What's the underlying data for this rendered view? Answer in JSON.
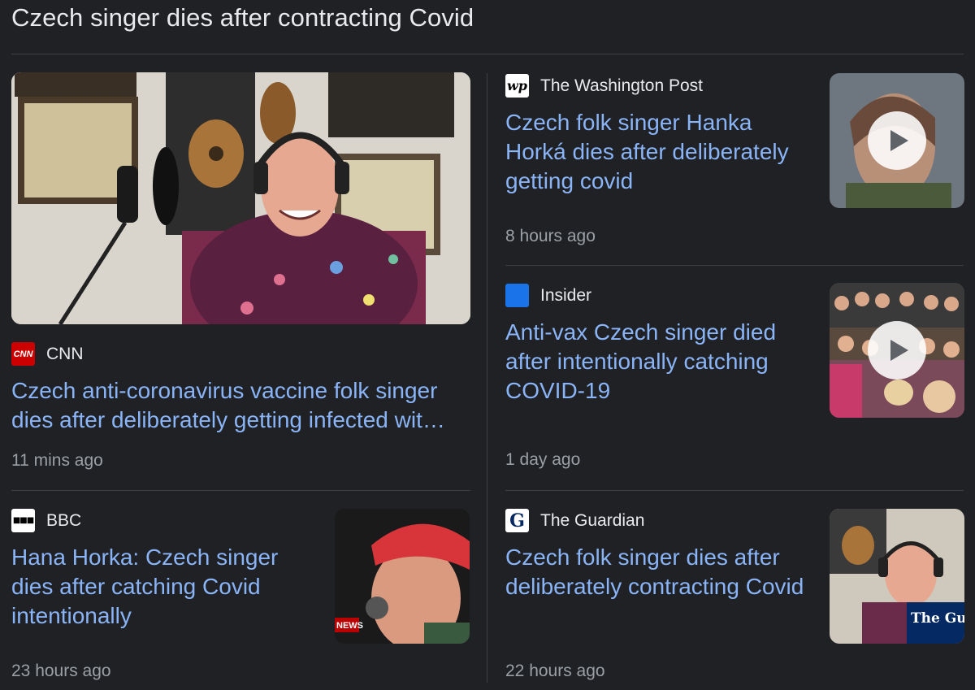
{
  "header": {
    "title": "Czech singer dies after contracting Covid"
  },
  "cards": [
    {
      "source": "CNN",
      "source_icon": "cnn-logo-icon",
      "title": "Czech anti-coronavirus vaccine folk singer dies after deliberately getting infected wit…",
      "time": "11 mins ago"
    },
    {
      "source": "BBC",
      "source_icon": "bbc-logo-icon",
      "title": "Hana Horka: Czech singer dies after catching Covid intentionally",
      "time": "23 hours ago",
      "thumb_overlay": "NEWS"
    },
    {
      "source": "The Washington Post",
      "source_icon": "washington-post-logo-icon",
      "title": "Czech folk singer Hanka Horká dies after deliberately getting covid",
      "time": "8 hours ago",
      "video": true
    },
    {
      "source": "Insider",
      "source_icon": "insider-logo-icon",
      "title": "Anti-vax Czech singer died after intentionally catching COVID-19",
      "time": "1 day ago",
      "video": true
    },
    {
      "source": "The Guardian",
      "source_icon": "guardian-logo-icon",
      "title": "Czech folk singer dies after deliberately contracting Covid",
      "time": "22 hours ago",
      "thumb_overlay": "The Guardi"
    }
  ],
  "icons": {
    "cnn": "CNN",
    "bbc": "■■■",
    "wapo": "wp",
    "guardian": "G"
  },
  "colors": {
    "background": "#202124",
    "link": "#8ab4f8",
    "cnn_red": "#cc0000",
    "insider_blue": "#1a73e8"
  }
}
